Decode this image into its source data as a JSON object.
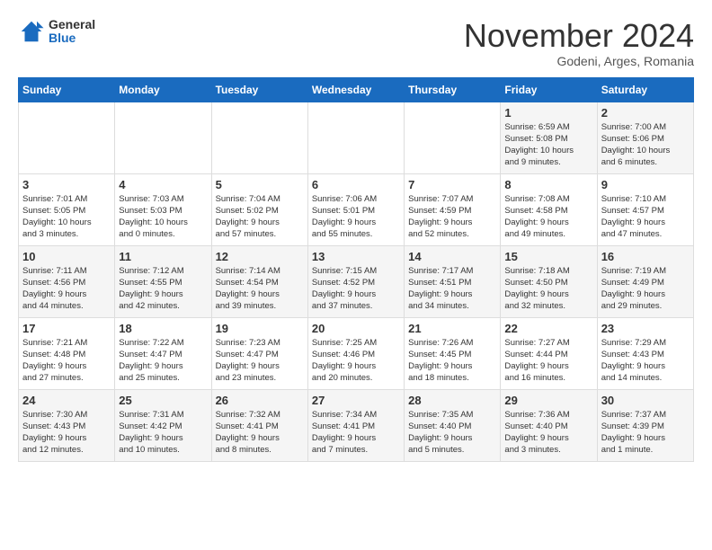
{
  "logo": {
    "general": "General",
    "blue": "Blue"
  },
  "title": "November 2024",
  "subtitle": "Godeni, Arges, Romania",
  "days_header": [
    "Sunday",
    "Monday",
    "Tuesday",
    "Wednesday",
    "Thursday",
    "Friday",
    "Saturday"
  ],
  "weeks": [
    [
      {
        "day": "",
        "info": ""
      },
      {
        "day": "",
        "info": ""
      },
      {
        "day": "",
        "info": ""
      },
      {
        "day": "",
        "info": ""
      },
      {
        "day": "",
        "info": ""
      },
      {
        "day": "1",
        "info": "Sunrise: 6:59 AM\nSunset: 5:08 PM\nDaylight: 10 hours\nand 9 minutes."
      },
      {
        "day": "2",
        "info": "Sunrise: 7:00 AM\nSunset: 5:06 PM\nDaylight: 10 hours\nand 6 minutes."
      }
    ],
    [
      {
        "day": "3",
        "info": "Sunrise: 7:01 AM\nSunset: 5:05 PM\nDaylight: 10 hours\nand 3 minutes."
      },
      {
        "day": "4",
        "info": "Sunrise: 7:03 AM\nSunset: 5:03 PM\nDaylight: 10 hours\nand 0 minutes."
      },
      {
        "day": "5",
        "info": "Sunrise: 7:04 AM\nSunset: 5:02 PM\nDaylight: 9 hours\nand 57 minutes."
      },
      {
        "day": "6",
        "info": "Sunrise: 7:06 AM\nSunset: 5:01 PM\nDaylight: 9 hours\nand 55 minutes."
      },
      {
        "day": "7",
        "info": "Sunrise: 7:07 AM\nSunset: 4:59 PM\nDaylight: 9 hours\nand 52 minutes."
      },
      {
        "day": "8",
        "info": "Sunrise: 7:08 AM\nSunset: 4:58 PM\nDaylight: 9 hours\nand 49 minutes."
      },
      {
        "day": "9",
        "info": "Sunrise: 7:10 AM\nSunset: 4:57 PM\nDaylight: 9 hours\nand 47 minutes."
      }
    ],
    [
      {
        "day": "10",
        "info": "Sunrise: 7:11 AM\nSunset: 4:56 PM\nDaylight: 9 hours\nand 44 minutes."
      },
      {
        "day": "11",
        "info": "Sunrise: 7:12 AM\nSunset: 4:55 PM\nDaylight: 9 hours\nand 42 minutes."
      },
      {
        "day": "12",
        "info": "Sunrise: 7:14 AM\nSunset: 4:54 PM\nDaylight: 9 hours\nand 39 minutes."
      },
      {
        "day": "13",
        "info": "Sunrise: 7:15 AM\nSunset: 4:52 PM\nDaylight: 9 hours\nand 37 minutes."
      },
      {
        "day": "14",
        "info": "Sunrise: 7:17 AM\nSunset: 4:51 PM\nDaylight: 9 hours\nand 34 minutes."
      },
      {
        "day": "15",
        "info": "Sunrise: 7:18 AM\nSunset: 4:50 PM\nDaylight: 9 hours\nand 32 minutes."
      },
      {
        "day": "16",
        "info": "Sunrise: 7:19 AM\nSunset: 4:49 PM\nDaylight: 9 hours\nand 29 minutes."
      }
    ],
    [
      {
        "day": "17",
        "info": "Sunrise: 7:21 AM\nSunset: 4:48 PM\nDaylight: 9 hours\nand 27 minutes."
      },
      {
        "day": "18",
        "info": "Sunrise: 7:22 AM\nSunset: 4:47 PM\nDaylight: 9 hours\nand 25 minutes."
      },
      {
        "day": "19",
        "info": "Sunrise: 7:23 AM\nSunset: 4:47 PM\nDaylight: 9 hours\nand 23 minutes."
      },
      {
        "day": "20",
        "info": "Sunrise: 7:25 AM\nSunset: 4:46 PM\nDaylight: 9 hours\nand 20 minutes."
      },
      {
        "day": "21",
        "info": "Sunrise: 7:26 AM\nSunset: 4:45 PM\nDaylight: 9 hours\nand 18 minutes."
      },
      {
        "day": "22",
        "info": "Sunrise: 7:27 AM\nSunset: 4:44 PM\nDaylight: 9 hours\nand 16 minutes."
      },
      {
        "day": "23",
        "info": "Sunrise: 7:29 AM\nSunset: 4:43 PM\nDaylight: 9 hours\nand 14 minutes."
      }
    ],
    [
      {
        "day": "24",
        "info": "Sunrise: 7:30 AM\nSunset: 4:43 PM\nDaylight: 9 hours\nand 12 minutes."
      },
      {
        "day": "25",
        "info": "Sunrise: 7:31 AM\nSunset: 4:42 PM\nDaylight: 9 hours\nand 10 minutes."
      },
      {
        "day": "26",
        "info": "Sunrise: 7:32 AM\nSunset: 4:41 PM\nDaylight: 9 hours\nand 8 minutes."
      },
      {
        "day": "27",
        "info": "Sunrise: 7:34 AM\nSunset: 4:41 PM\nDaylight: 9 hours\nand 7 minutes."
      },
      {
        "day": "28",
        "info": "Sunrise: 7:35 AM\nSunset: 4:40 PM\nDaylight: 9 hours\nand 5 minutes."
      },
      {
        "day": "29",
        "info": "Sunrise: 7:36 AM\nSunset: 4:40 PM\nDaylight: 9 hours\nand 3 minutes."
      },
      {
        "day": "30",
        "info": "Sunrise: 7:37 AM\nSunset: 4:39 PM\nDaylight: 9 hours\nand 1 minute."
      }
    ]
  ]
}
